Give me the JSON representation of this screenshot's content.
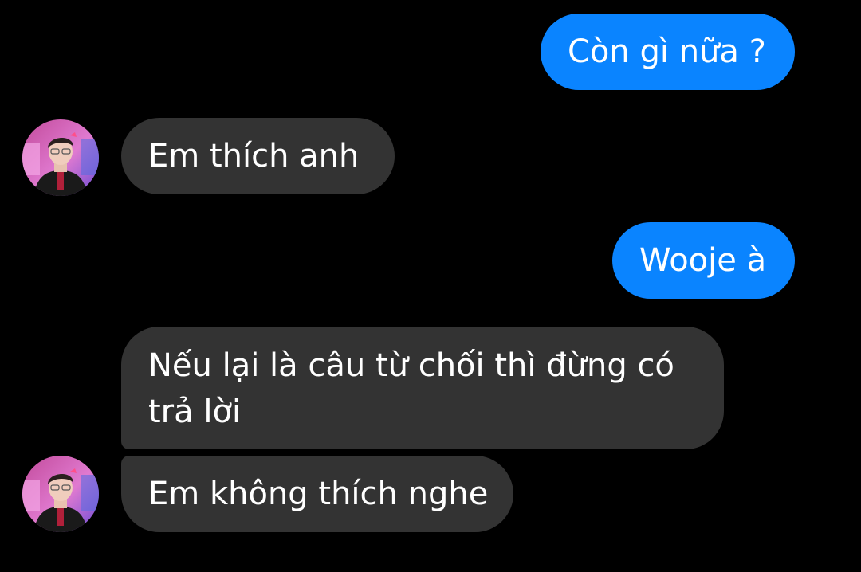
{
  "conversation": {
    "messages": [
      {
        "sender": "me",
        "text": "Còn gì nữa ?"
      },
      {
        "sender": "other",
        "text": "Em thích anh"
      },
      {
        "sender": "me",
        "text": "Wooje à"
      },
      {
        "sender": "other",
        "text": "Nếu lại là câu từ chối thì đừng có trả lời"
      },
      {
        "sender": "other",
        "text": "Em không thích nghe"
      }
    ],
    "avatar_icon": "profile-photo-avatar"
  },
  "colors": {
    "background": "#000000",
    "outgoing_bubble": "#0a84ff",
    "incoming_bubble": "#333333",
    "text": "#ffffff"
  }
}
